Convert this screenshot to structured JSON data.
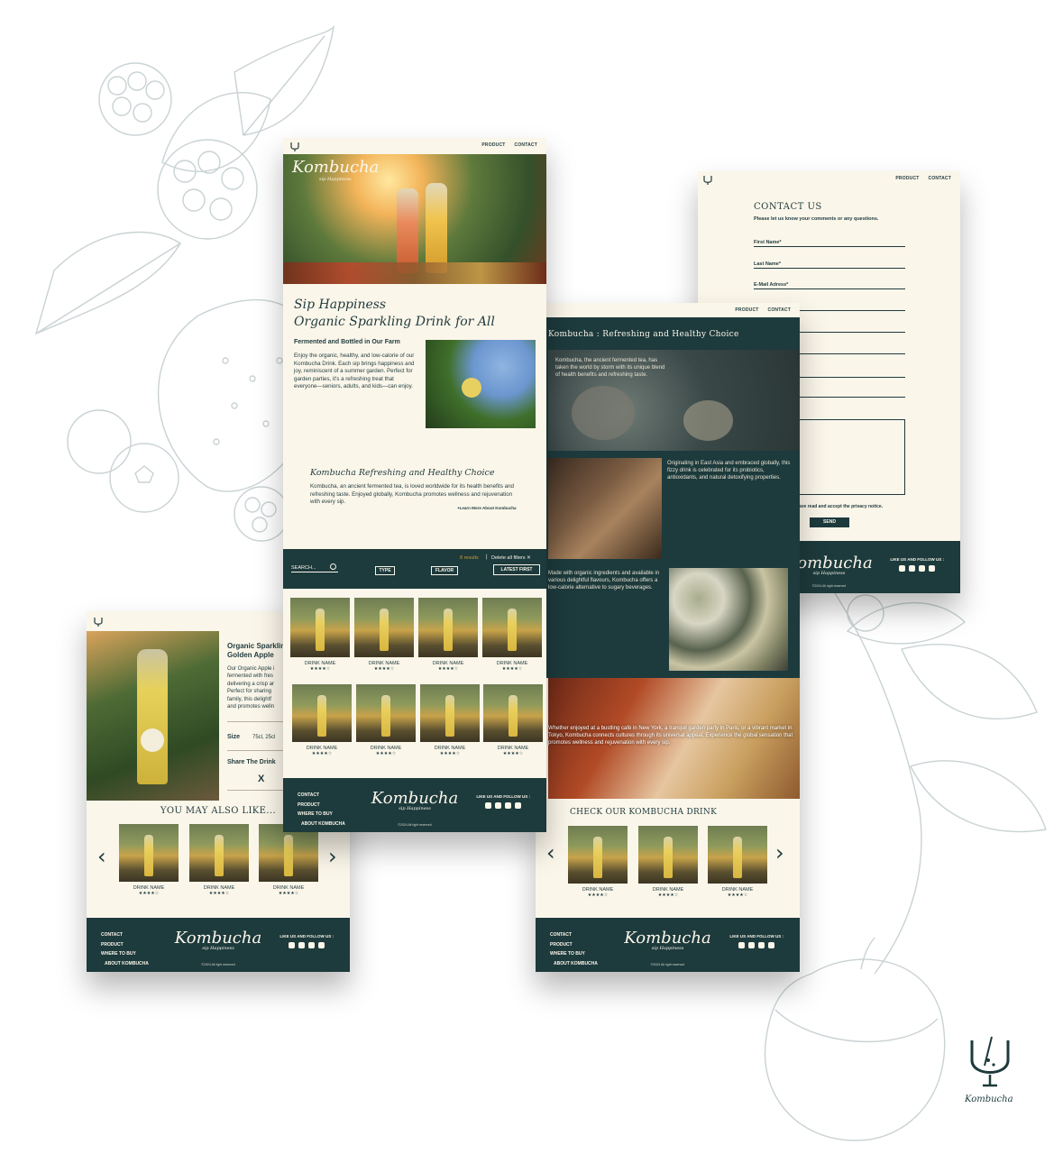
{
  "nav": {
    "product": "PRODUCT",
    "contact": "CONTACT"
  },
  "home": {
    "hero_brand": "Kombucha",
    "hero_tagline": "sip Happiness",
    "headline_1": "Sip Happiness",
    "headline_2": "Organic Sparkling Drink for All",
    "sub_heading": "Fermented and Bottled in Our Farm",
    "body": "Enjoy the organic, healthy, and low-calorie of our Kombucha Drink. Each sip brings happiness and joy, reminiscent of a summer garden. Perfect for garden parties, it's a refreshing treat that everyone—seniors, adults, and kids—can enjoy.",
    "section_title": "Kombucha Refreshing and Healthy Choice",
    "section_body": "Kombucha, an ancient fermented tea, is loved worldwide for its health benefits and refreshing taste. Enjoyed globally, Kombucha promotes wellness and rejuvenation with every sip.",
    "learn_more": "+Learn More About Kombucha"
  },
  "filter": {
    "results": "8 results",
    "delete_all": "Delete all filters",
    "search": "SEARCH...",
    "type": "TYPE",
    "flavor": "FLAVOR",
    "latest": "LATEST FIRST"
  },
  "products": [
    {
      "name": "DRINK NAME",
      "stars": "★★★★☆"
    },
    {
      "name": "DRINK NAME",
      "stars": "★★★★☆"
    },
    {
      "name": "DRINK NAME",
      "stars": "★★★★☆"
    },
    {
      "name": "DRINK NAME",
      "stars": "★★★★☆"
    },
    {
      "name": "DRINK NAME",
      "stars": "★★★★☆"
    },
    {
      "name": "DRINK NAME",
      "stars": "★★★★☆"
    },
    {
      "name": "DRINK NAME",
      "stars": "★★★★☆"
    },
    {
      "name": "DRINK NAME",
      "stars": "★★★★☆"
    }
  ],
  "footer": {
    "links": [
      "CONTACT",
      "PRODUCT",
      "WHERE TO BUY",
      "ABOUT KOMBUCHA"
    ],
    "brand": "Kombucha",
    "tagline": "sip Happiness",
    "follow": "LIKE US AND FOLLOW US :",
    "copyright": "©2024 All right reserved"
  },
  "contact": {
    "title": "CONTACT US",
    "subtitle": "Please let us know your comments or any questions.",
    "first_name": "First Name*",
    "last_name": "Last Name*",
    "email": "E-Mail Adress*",
    "privacy": "ave read and accept the privacy notice.",
    "send": "SEND"
  },
  "about": {
    "title": "Kombucha : Refreshing and Healthy Choice",
    "p1": "Kombucha, the ancient fermented tea, has taken the world by storm with its unique blend of health benefits and refreshing taste.",
    "p2": "Originating in East Asia and embraced globally, this fizzy drink is celebrated for its probiotics, antioxidants, and natural detoxifying properties.",
    "p3": "Made with organic ingredients and available in various delightful flavours, Kombucha offers a low-calorie alternative to sugary beverages.",
    "p4": "Whether enjoyed at a bustling café in New York, a tranquil garden party in Paris, or a vibrant market in Tokyo, Kombucha connects cultures through its universal appeal. Experience the global sensation that promotes wellness and rejuvenation with every sip.",
    "check": "CHECK OUR KOMBUCHA DRINK"
  },
  "detail": {
    "title_1": "Organic Sparklin",
    "title_2": "Golden Apple",
    "desc_lines": [
      "Our Organic Apple i",
      "fermented with fres",
      "delivering a crisp ar",
      "Perfect for sharing",
      "family, this delightf",
      "and promotes welln"
    ],
    "size_label": "Size",
    "size_value": "75cl, 25cl",
    "share": "Share The Drink",
    "x_mark": "X",
    "also_like": "YOU MAY ALSO LIKE..."
  },
  "carousel_items": [
    {
      "name": "DRINK NAME",
      "stars": "★★★★☆"
    },
    {
      "name": "DRINK NAME",
      "stars": "★★★★☆"
    },
    {
      "name": "DRINK NAME",
      "stars": "★★★★☆"
    }
  ],
  "corner_logo": "Kombucha",
  "colors": {
    "cream": "#fbf6ea",
    "teal": "#1d3a3c",
    "accent": "#c89a3a"
  }
}
